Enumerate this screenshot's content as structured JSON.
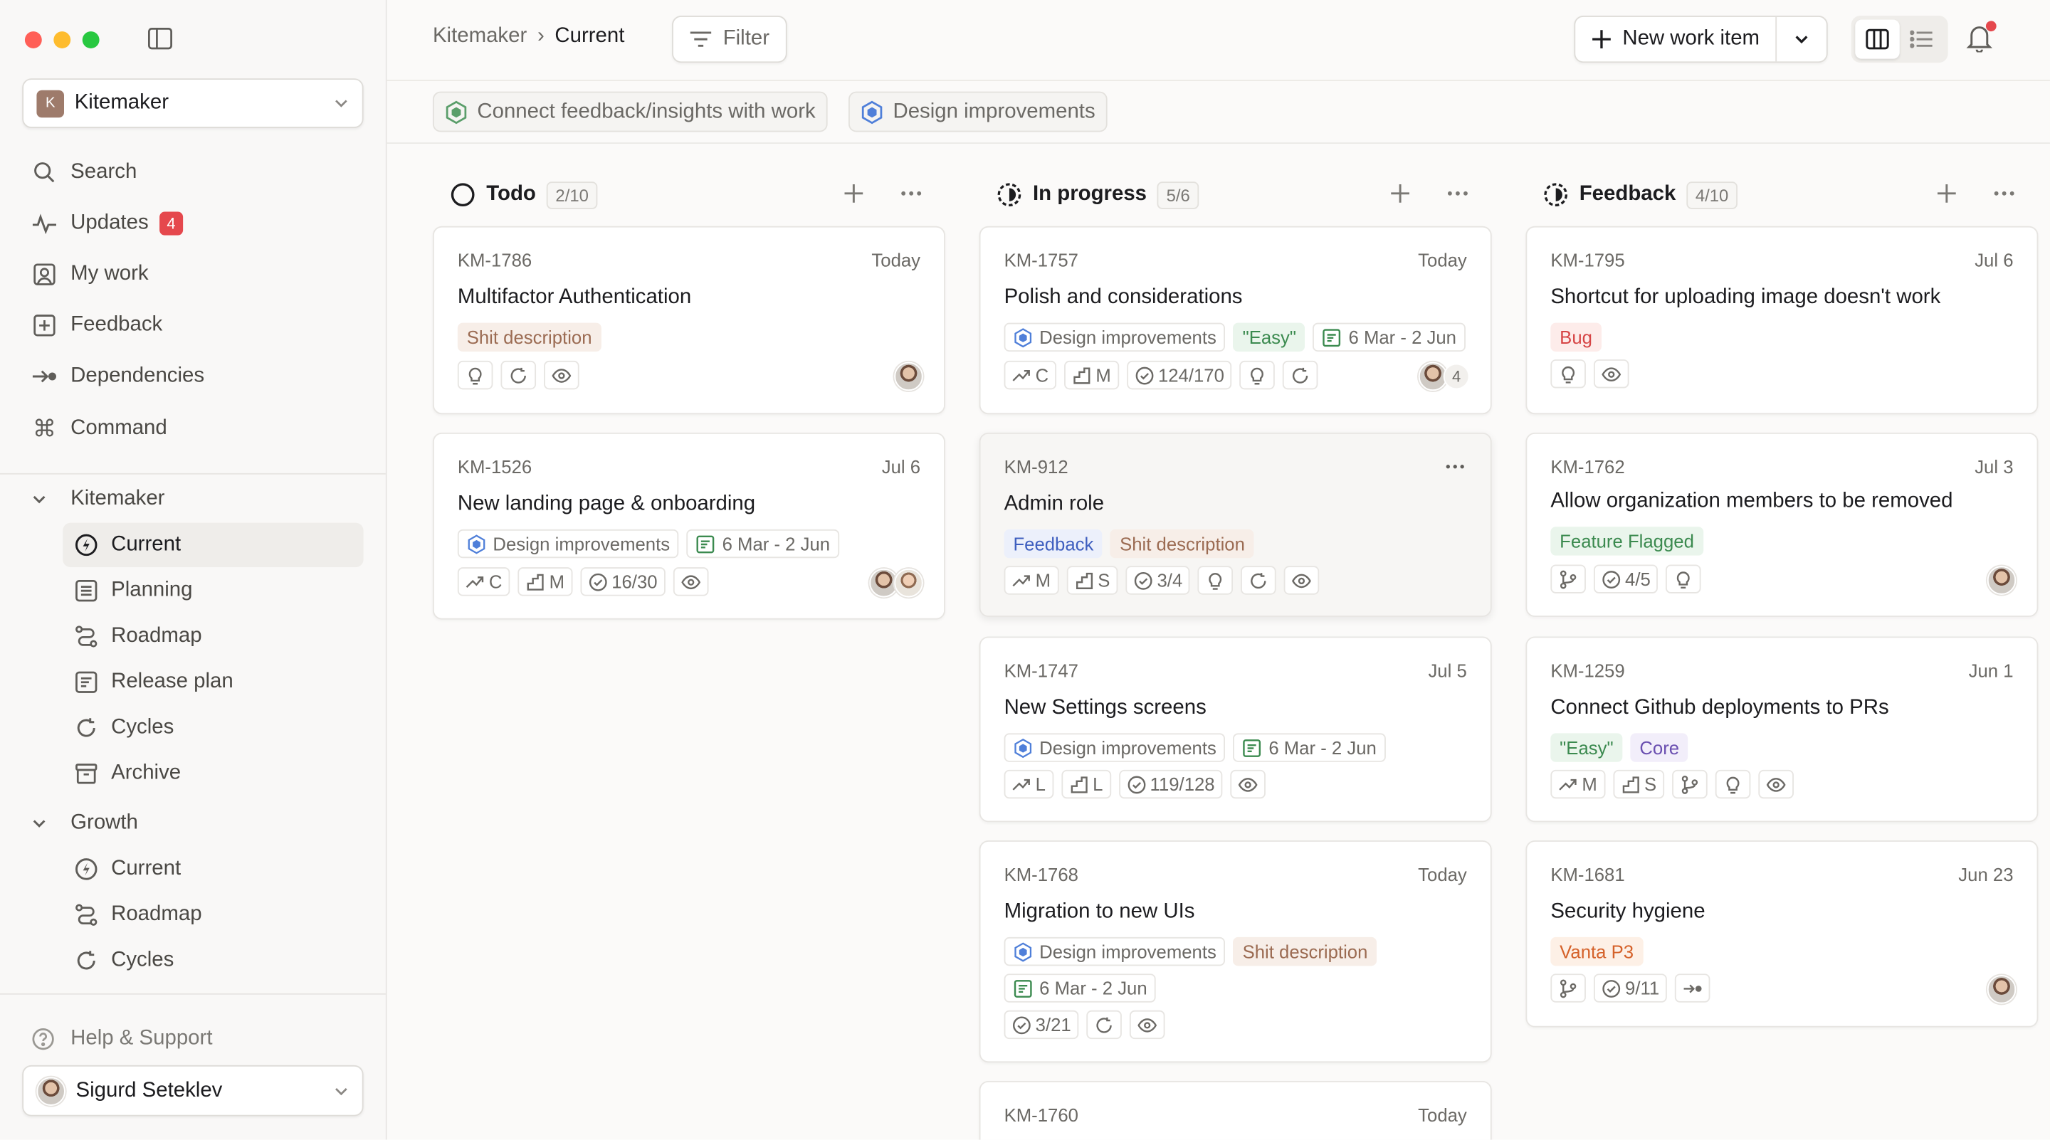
{
  "sidebar": {
    "workspace": {
      "initial": "K",
      "name": "Kitemaker"
    },
    "nav": [
      {
        "label": "Search",
        "icon": "search-icon"
      },
      {
        "label": "Updates",
        "icon": "activity-icon",
        "badge": "4"
      },
      {
        "label": "My work",
        "icon": "user-square-icon"
      },
      {
        "label": "Feedback",
        "icon": "feedback-plus-icon"
      },
      {
        "label": "Dependencies",
        "icon": "dependency-arrow-icon"
      },
      {
        "label": "Command",
        "icon": "command-icon"
      }
    ],
    "spaces": [
      {
        "name": "Kitemaker",
        "items": [
          {
            "label": "Current",
            "icon": "bolt-circle-icon",
            "active": true
          },
          {
            "label": "Planning",
            "icon": "list-board-icon"
          },
          {
            "label": "Roadmap",
            "icon": "roadmap-icon"
          },
          {
            "label": "Release plan",
            "icon": "release-doc-icon"
          },
          {
            "label": "Cycles",
            "icon": "cycle-icon"
          },
          {
            "label": "Archive",
            "icon": "archive-icon"
          }
        ]
      },
      {
        "name": "Growth",
        "items": [
          {
            "label": "Current",
            "icon": "bolt-circle-icon"
          },
          {
            "label": "Roadmap",
            "icon": "roadmap-icon"
          },
          {
            "label": "Cycles",
            "icon": "cycle-icon"
          }
        ]
      }
    ],
    "help": "Help & Support",
    "user": "Sigurd Seteklev"
  },
  "topbar": {
    "breadcrumb": {
      "parent": "Kitemaker",
      "separator": "›",
      "current": "Current"
    },
    "filter_label": "Filter",
    "new_label": "New work item"
  },
  "filters": [
    {
      "label": "Connect feedback/insights with work",
      "color": "#5a9e6a"
    },
    {
      "label": "Design improvements",
      "color": "#4f7fd9"
    }
  ],
  "columns": [
    {
      "title": "Todo",
      "count": "2/10",
      "cards": [
        {
          "key": "KM-1786",
          "date": "Today",
          "title": "Multifactor Authentication",
          "tags": [
            {
              "text": "Shit description",
              "style": "brown"
            }
          ],
          "pills": [
            {
              "icon": "bulb-icon"
            },
            {
              "icon": "cycle-icon"
            },
            {
              "icon": "eye-icon"
            }
          ]
        },
        {
          "key": "KM-1526",
          "date": "Jul 6",
          "title": "New landing page & onboarding",
          "tags": [
            {
              "text": "Design improvements",
              "style": "init"
            },
            {
              "text": "6 Mar - 2 Jun",
              "style": "date"
            }
          ],
          "pills": [
            {
              "icon": "trend-icon",
              "text": "C"
            },
            {
              "icon": "effort-icon",
              "text": "M"
            },
            {
              "icon": "check-circle-icon",
              "text": "16/30"
            },
            {
              "icon": "eye-icon"
            }
          ]
        }
      ]
    },
    {
      "title": "In progress",
      "count": "5/6",
      "cards": [
        {
          "key": "KM-1757",
          "date": "Today",
          "title": "Polish and considerations",
          "tags": [
            {
              "text": "Design improvements",
              "style": "init"
            },
            {
              "text": "\"Easy\"",
              "style": "green"
            },
            {
              "text": "6 Mar - 2 Jun",
              "style": "date"
            }
          ],
          "pills": [
            {
              "icon": "trend-icon",
              "text": "C"
            },
            {
              "icon": "effort-icon",
              "text": "M"
            },
            {
              "icon": "check-circle-icon",
              "text": "124/170"
            },
            {
              "icon": "bulb-icon"
            },
            {
              "icon": "cycle-icon"
            }
          ],
          "extra_watchers": "4"
        },
        {
          "key": "KM-912",
          "title": "Admin role",
          "tags": [
            {
              "text": "Feedback",
              "style": "blue"
            },
            {
              "text": "Shit description",
              "style": "brown"
            }
          ],
          "pills": [
            {
              "icon": "trend-icon",
              "text": "M"
            },
            {
              "icon": "effort-icon",
              "text": "S"
            },
            {
              "icon": "check-circle-icon",
              "text": "3/4"
            },
            {
              "icon": "bulb-icon"
            },
            {
              "icon": "cycle-icon"
            },
            {
              "icon": "eye-icon"
            }
          ]
        },
        {
          "key": "KM-1747",
          "date": "Jul 5",
          "title": "New Settings screens",
          "tags": [
            {
              "text": "Design improvements",
              "style": "init"
            },
            {
              "text": "6 Mar - 2 Jun",
              "style": "date"
            }
          ],
          "pills": [
            {
              "icon": "trend-icon",
              "text": "L"
            },
            {
              "icon": "effort-icon",
              "text": "L"
            },
            {
              "icon": "check-circle-icon",
              "text": "119/128"
            },
            {
              "icon": "eye-icon"
            }
          ]
        },
        {
          "key": "KM-1768",
          "date": "Today",
          "title": "Migration to new UIs",
          "tags": [
            {
              "text": "Design improvements",
              "style": "init"
            },
            {
              "text": "Shit description",
              "style": "brown"
            }
          ],
          "tags2": [
            {
              "text": "6 Mar - 2 Jun",
              "style": "date"
            }
          ],
          "pills": [
            {
              "icon": "check-circle-icon",
              "text": "3/21"
            },
            {
              "icon": "cycle-icon"
            },
            {
              "icon": "eye-icon"
            }
          ]
        },
        {
          "key": "KM-1760",
          "date": "Today"
        }
      ]
    },
    {
      "title": "Feedback",
      "count": "4/10",
      "cards": [
        {
          "key": "KM-1795",
          "date": "Jul 6",
          "title": "Shortcut for uploading image doesn't work",
          "tags": [
            {
              "text": "Bug",
              "style": "red"
            }
          ],
          "pills": [
            {
              "icon": "bulb-icon"
            },
            {
              "icon": "eye-icon"
            }
          ]
        },
        {
          "key": "KM-1762",
          "date": "Jul 3",
          "title": "Allow organization members to be removed",
          "tags": [
            {
              "text": "Feature Flagged",
              "style": "green"
            }
          ],
          "pills": [
            {
              "icon": "branch-icon"
            },
            {
              "icon": "check-circle-icon",
              "text": "4/5"
            },
            {
              "icon": "bulb-icon"
            }
          ]
        },
        {
          "key": "KM-1259",
          "date": "Jun 1",
          "title": "Connect Github deployments to PRs",
          "tags": [
            {
              "text": "\"Easy\"",
              "style": "green"
            },
            {
              "text": "Core",
              "style": "purple"
            }
          ],
          "pills": [
            {
              "icon": "trend-icon",
              "text": "M"
            },
            {
              "icon": "effort-icon",
              "text": "S"
            },
            {
              "icon": "branch-icon"
            },
            {
              "icon": "bulb-icon"
            },
            {
              "icon": "eye-icon"
            }
          ]
        },
        {
          "key": "KM-1681",
          "date": "Jun 23",
          "title": "Security hygiene",
          "tags": [
            {
              "text": "Vanta P3",
              "style": "orange"
            }
          ],
          "pills": [
            {
              "icon": "branch-icon"
            },
            {
              "icon": "check-circle-icon",
              "text": "9/11"
            },
            {
              "icon": "dependency-arrow-icon"
            }
          ]
        }
      ]
    }
  ]
}
